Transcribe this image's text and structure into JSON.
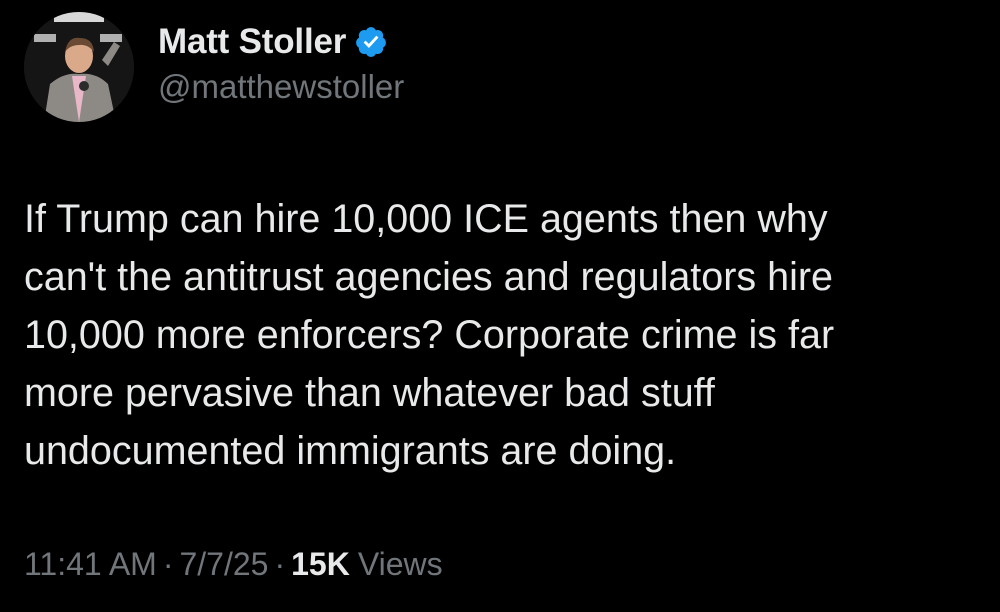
{
  "author": {
    "display_name": "Matt Stoller",
    "handle": "@matthewstoller",
    "verified_icon": "verified-badge-icon",
    "badge_color": "#1d9bf0",
    "avatar": "profile-photo"
  },
  "tweet": {
    "text": "If Trump can hire 10,000 ICE agents then why\ncan't the antitrust agencies and regulators hire\n10,000 more enforcers? Corporate crime is far\nmore pervasive than whatever bad stuff\nundocumented immigrants are doing."
  },
  "meta": {
    "time": "11:41 AM",
    "separator": "·",
    "date": "7/7/25",
    "views_count": "15K",
    "views_label": "Views"
  },
  "colors": {
    "background": "#000000",
    "primary_text": "#e7e9ea",
    "secondary_text": "#71767b"
  }
}
